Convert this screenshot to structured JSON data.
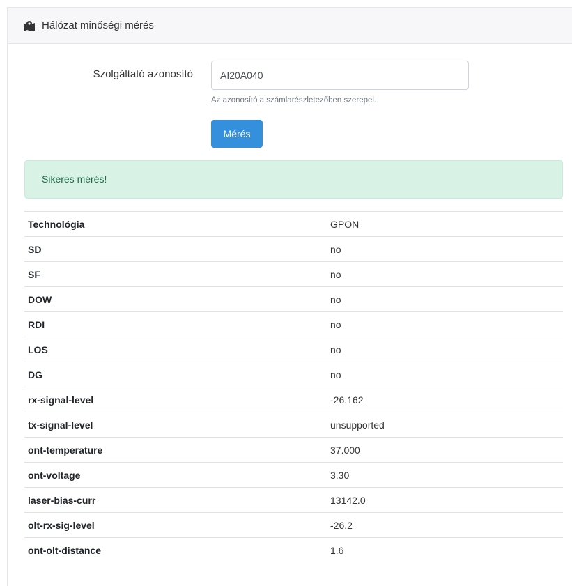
{
  "header": {
    "icon": "map-marker-icon",
    "title": "Hálózat minőségi mérés"
  },
  "form": {
    "label": "Szolgáltató azonosító",
    "value": "AI20A040",
    "help": "Az azonosító a számlarészletezőben szerepel.",
    "button_label": "Mérés"
  },
  "alert": {
    "text": "Sikeres mérés!"
  },
  "results": [
    {
      "key": "Technológia",
      "value": "GPON"
    },
    {
      "key": "SD",
      "value": "no"
    },
    {
      "key": "SF",
      "value": "no"
    },
    {
      "key": "DOW",
      "value": "no"
    },
    {
      "key": "RDI",
      "value": "no"
    },
    {
      "key": "LOS",
      "value": "no"
    },
    {
      "key": "DG",
      "value": "no"
    },
    {
      "key": "rx-signal-level",
      "value": "-26.162"
    },
    {
      "key": "tx-signal-level",
      "value": "unsupported"
    },
    {
      "key": "ont-temperature",
      "value": "37.000"
    },
    {
      "key": "ont-voltage",
      "value": "3.30"
    },
    {
      "key": "laser-bias-curr",
      "value": "13142.0"
    },
    {
      "key": "olt-rx-sig-level",
      "value": "-26.2"
    },
    {
      "key": "ont-olt-distance",
      "value": "1.6"
    }
  ]
}
